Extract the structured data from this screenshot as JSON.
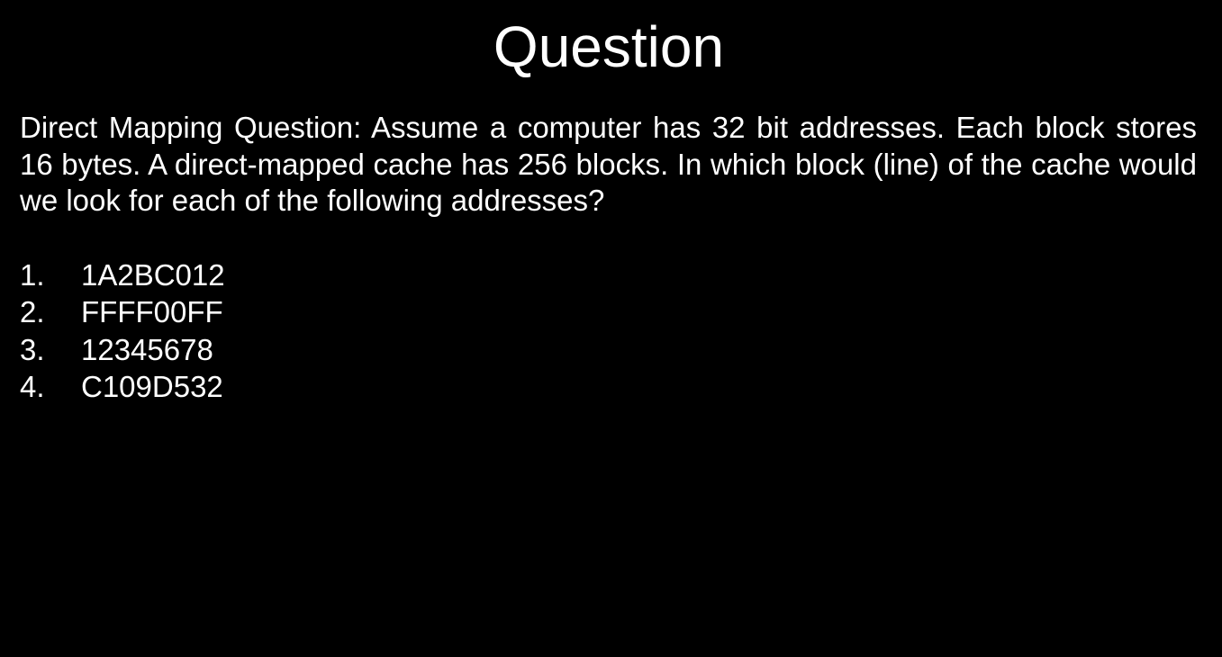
{
  "slide": {
    "title": "Question",
    "question": "Direct Mapping Question: Assume a computer has 32 bit addresses. Each block stores 16 bytes. A direct-mapped cache has 256 blocks. In which block (line) of the cache would we look for each of the following addresses?",
    "addresses": [
      {
        "number": "1.",
        "value": "1A2BC012"
      },
      {
        "number": "2.",
        "value": "FFFF00FF"
      },
      {
        "number": "3.",
        "value": "12345678"
      },
      {
        "number": "4.",
        "value": "C109D532"
      }
    ]
  },
  "colors": {
    "background": "#000000",
    "text": "#ffffff"
  }
}
